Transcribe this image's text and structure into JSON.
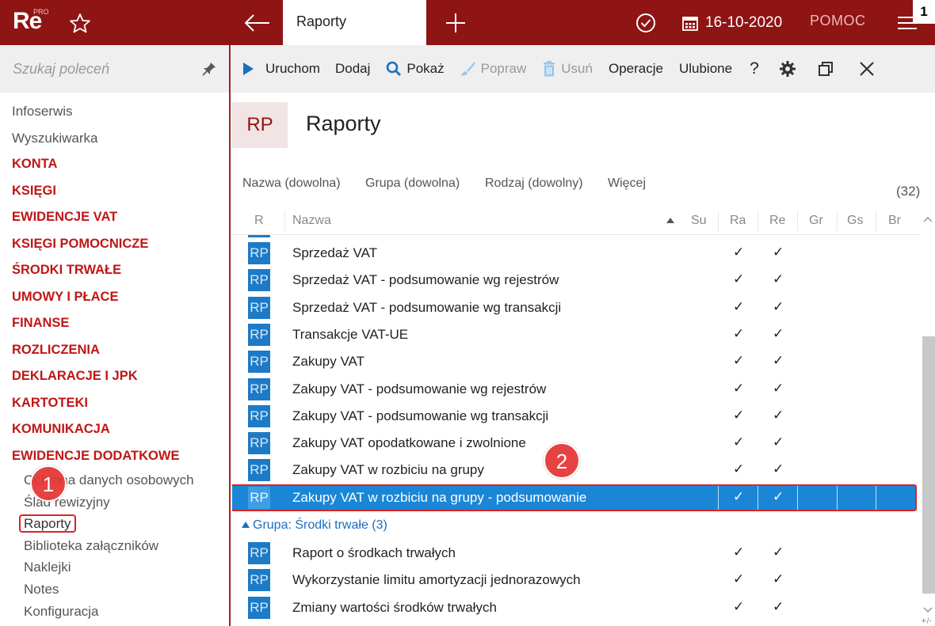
{
  "app": {
    "logo_text": "Re",
    "logo_sup": "PRO",
    "active_tab": "Raporty",
    "date": "16-10-2020",
    "help": "POMOC",
    "window_number": "1"
  },
  "sidebar": {
    "search_placeholder": "Szukaj poleceń",
    "items": [
      {
        "label": "Infoserwis",
        "type": "plain"
      },
      {
        "label": "Wyszukiwarka",
        "type": "plain"
      },
      {
        "label": "KONTA",
        "type": "cat"
      },
      {
        "label": "KSIĘGI",
        "type": "cat"
      },
      {
        "label": "EWIDENCJE VAT",
        "type": "cat"
      },
      {
        "label": "KSIĘGI POMOCNICZE",
        "type": "cat"
      },
      {
        "label": "ŚRODKI TRWAŁE",
        "type": "cat"
      },
      {
        "label": "UMOWY I PŁACE",
        "type": "cat"
      },
      {
        "label": "FINANSE",
        "type": "cat"
      },
      {
        "label": "ROZLICZENIA",
        "type": "cat"
      },
      {
        "label": "DEKLARACJE I JPK",
        "type": "cat"
      },
      {
        "label": "KARTOTEKI",
        "type": "cat"
      },
      {
        "label": "KOMUNIKACJA",
        "type": "cat"
      },
      {
        "label": "EWIDENCJE DODATKOWE",
        "type": "cat"
      }
    ],
    "sub_items": [
      "Ochrona danych osobowych",
      "Ślad rewizyjny",
      "Raporty",
      "Biblioteka załączników",
      "Naklejki",
      "Notes",
      "Konfiguracja"
    ]
  },
  "toolbar": {
    "run": "Uruchom",
    "add": "Dodaj",
    "show": "Pokaż",
    "edit": "Popraw",
    "delete": "Usuń",
    "operations": "Operacje",
    "favorites": "Ulubione",
    "help": "?"
  },
  "title": {
    "badge": "RP",
    "text": "Raporty"
  },
  "filters": {
    "name": "Nazwa (dowolna)",
    "group": "Grupa (dowolna)",
    "kind": "Rodzaj (dowolny)",
    "more": "Więcej",
    "count": "(32)"
  },
  "grid": {
    "columns": [
      "R",
      "Nazwa",
      "Su",
      "Ra",
      "Re",
      "Gr",
      "Gs",
      "Br"
    ],
    "icon_label": "RP",
    "check": "✓",
    "rows": [
      "Sprzedaż VAT",
      "Sprzedaż VAT - podsumowanie wg rejestrów",
      "Sprzedaż VAT - podsumowanie wg transakcji",
      "Transakcje VAT-UE",
      "Zakupy VAT",
      "Zakupy VAT - podsumowanie wg rejestrów",
      "Zakupy VAT - podsumowanie wg transakcji",
      "Zakupy VAT opodatkowane i zwolnione",
      "Zakupy VAT w rozbiciu na grupy",
      "Zakupy VAT w rozbiciu na grupy - podsumowanie"
    ],
    "group_label_prefix": "Grupa: ",
    "group_label_name": "Środki trwałe",
    "group_label_count": "(3)",
    "group_rows": [
      "Raport o środkach trwałych",
      "Wykorzystanie limitu amortyzacji jednorazowych",
      "Zmiany wartości środków trwałych"
    ],
    "footer": "+/-"
  },
  "callouts": [
    "1",
    "2"
  ],
  "colors": {
    "brand": "#8f1414",
    "category": "#c01616",
    "selected": "#1b86d6",
    "icon": "#1d7ac6",
    "callout": "#e53333"
  }
}
